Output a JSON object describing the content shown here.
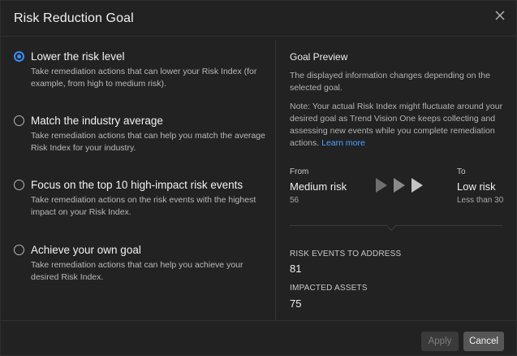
{
  "dialog": {
    "title": "Risk Reduction Goal",
    "close_icon": "close-icon"
  },
  "options": [
    {
      "title": "Lower the risk level",
      "description": "Take remediation actions that can lower your Risk Index (for example, from high to medium risk).",
      "selected": true
    },
    {
      "title": "Match the industry average",
      "description": "Take remediation actions that can help you match the average Risk Index for your industry.",
      "selected": false
    },
    {
      "title": "Focus on the top 10 high-impact risk events",
      "description": "Take remediation actions on the risk events with the highest impact on your Risk Index.",
      "selected": false
    },
    {
      "title": "Achieve your own goal",
      "description": "Take remediation actions that can help you achieve your desired Risk Index.",
      "selected": false
    }
  ],
  "preview": {
    "title": "Goal Preview",
    "intro": "The displayed information changes depending on the selected goal.",
    "note": "Note: Your actual Risk Index might fluctuate around your desired goal as Trend Vision One keeps collecting and assessing new events while you complete remediation actions.",
    "learn_more": "Learn more",
    "from_label": "From",
    "from_value": "Medium risk",
    "from_sub": "56",
    "to_label": "To",
    "to_value": "Low risk",
    "to_sub": "Less than 30",
    "risk_events_label": "RISK EVENTS TO ADDRESS",
    "risk_events_value": "81",
    "impacted_assets_label": "IMPACTED ASSETS",
    "impacted_assets_value": "75"
  },
  "buttons": {
    "apply": "Apply",
    "cancel": "Cancel"
  },
  "colors": {
    "accent": "#3b8ef5",
    "link": "#4aa3ff",
    "background": "#222223"
  }
}
